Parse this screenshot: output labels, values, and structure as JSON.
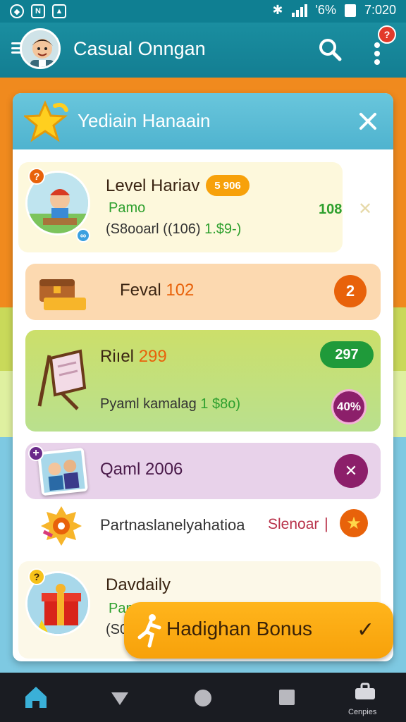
{
  "status_bar": {
    "time": "7:020",
    "battery": "'6%",
    "icons": [
      "shield-icon",
      "n-icon",
      "image-icon",
      "wifi-icon",
      "signal-icon",
      "battery-icon"
    ]
  },
  "app_bar": {
    "title": "Casual Onngan",
    "notification_count": "?"
  },
  "dialog": {
    "title": "Yediain Hanaain",
    "items": [
      {
        "title": "Level Hariav",
        "badge": "5 906",
        "subtitle": "Pamo",
        "detail_prefix": "(S8ooarl ((106)",
        "detail_value": "1.$9-)",
        "value": "108",
        "corner_badge": "?"
      },
      {
        "title_prefix": "Feval",
        "title_number": "102",
        "circle_value": "2"
      },
      {
        "title_prefix": "Riıel",
        "title_number": "299",
        "pill_value": "297",
        "subtitle": "Pyaml kamalag",
        "subtitle_value": "1 $8o)",
        "percent": "40%"
      },
      {
        "title_prefix": "Qaml",
        "title_number": "2006",
        "circle_icon": "x-icon",
        "corner_badge": "+"
      },
      {
        "title": "Partnaslanelyahatioa",
        "tag": "Slenoar",
        "separator": "|"
      },
      {
        "title": "Davdaily",
        "subtitle": "Pam",
        "detail": "(S06",
        "corner_badge": "?"
      }
    ]
  },
  "bonus": {
    "label": "Hadighan Bonus"
  },
  "nav_bar": {
    "corner_label": "Cenpies"
  },
  "colors": {
    "teal": "#137e92",
    "orange": "#f08a1e",
    "green_accent": "#2ea02e",
    "purple": "#8c1f6a",
    "bonus": "#f7a10a"
  }
}
